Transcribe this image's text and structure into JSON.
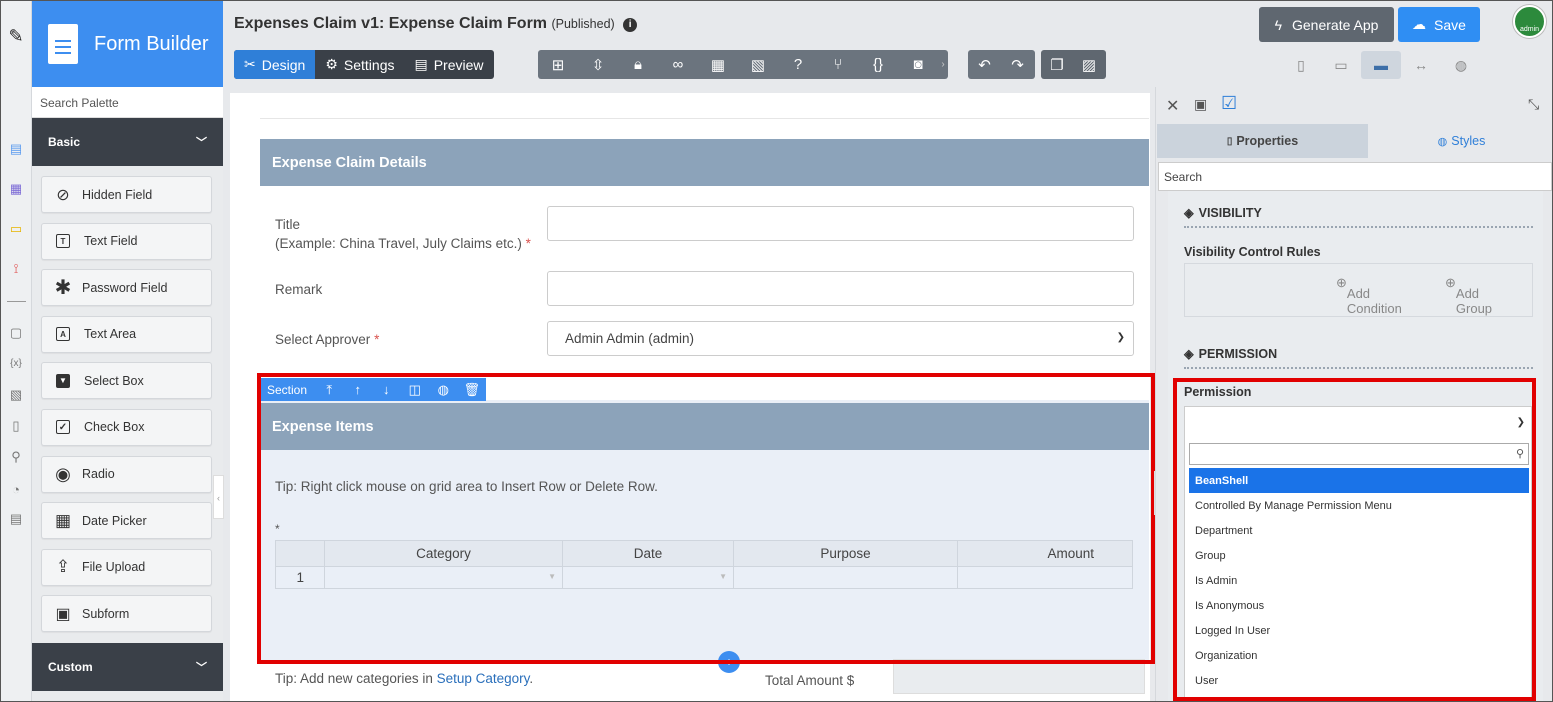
{
  "palette": {
    "brand": "Form Builder",
    "search_placeholder": "Search Palette",
    "basic_label": "Basic",
    "custom_label": "Custom",
    "items": [
      {
        "label": "Hidden Field",
        "icon": "eye-slash-icon",
        "glyph": "◉"
      },
      {
        "label": "Text Field",
        "icon": "text-field-icon",
        "glyph": "T"
      },
      {
        "label": "Password Field",
        "icon": "asterisk-icon",
        "glyph": "✱"
      },
      {
        "label": "Text Area",
        "icon": "text-area-icon",
        "glyph": "A"
      },
      {
        "label": "Select Box",
        "icon": "select-box-icon",
        "glyph": "▼"
      },
      {
        "label": "Check Box",
        "icon": "check-box-icon",
        "glyph": "✓"
      },
      {
        "label": "Radio",
        "icon": "radio-icon",
        "glyph": "◉"
      },
      {
        "label": "Date Picker",
        "icon": "calendar-icon",
        "glyph": "▦"
      },
      {
        "label": "File Upload",
        "icon": "upload-icon",
        "glyph": "⇪"
      },
      {
        "label": "Subform",
        "icon": "subform-icon",
        "glyph": "▣"
      }
    ]
  },
  "header": {
    "title": "Expenses Claim v1: Expense Claim Form",
    "status": "(Published)",
    "modes": [
      "Design",
      "Settings",
      "Preview"
    ],
    "generate_label": "Generate App",
    "save_label": "Save",
    "avatar_text": "admin"
  },
  "form": {
    "section1_title": "Expense Claim Details",
    "title_label": "Title",
    "title_hint": "(Example: China Travel, July Claims etc.)",
    "remark_label": "Remark",
    "approver_label": "Select Approver",
    "approver_value": "Admin Admin (admin)",
    "section_tool_label": "Section",
    "section2_title": "Expense Items",
    "grid_tip": "Tip: Right click mouse on grid area to Insert Row or Delete Row.",
    "grid_columns": [
      "Category",
      "Date",
      "Purpose",
      "Amount"
    ],
    "grid_row_number": "1",
    "bottom_tip": "Tip: Add new categories in",
    "bottom_tip_link": "Setup Category",
    "bottom_tip_end": ".",
    "total_label": "Total Amount $"
  },
  "panel": {
    "tab_properties": "Properties",
    "tab_styles": "Styles",
    "search_placeholder": "Search",
    "visibility_heading": "VISIBILITY",
    "visibility_rules_label": "Visibility Control Rules",
    "add_condition": "Add Condition",
    "add_group": "Add Group",
    "permission_heading": "PERMISSION",
    "permission_label": "Permission",
    "options": [
      "BeanShell",
      "Controlled By Manage Permission Menu",
      "Department",
      "Group",
      "Is Admin",
      "Is Anonymous",
      "Logged In User",
      "Organization",
      "User"
    ]
  },
  "colors": {
    "brand_blue": "#3d8ef0",
    "highlight_red": "#e10000",
    "section_header": "#8ca3ba"
  }
}
